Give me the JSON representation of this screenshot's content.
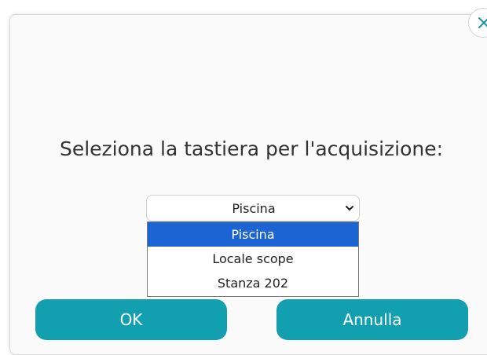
{
  "dialog": {
    "title": "Seleziona la tastiera per l'acquisizione:",
    "close_icon": "close-icon"
  },
  "select": {
    "value": "Piscina",
    "chevron_icon": "chevron-down-icon",
    "options": [
      "Piscina",
      "Locale scope",
      "Stanza 202"
    ],
    "selected_index": 0
  },
  "buttons": {
    "ok_label": "OK",
    "cancel_label": "Annulla"
  },
  "colors": {
    "accent": "#12a0b0",
    "selection": "#1c63d4",
    "close_icon": "#1a8fb0"
  }
}
